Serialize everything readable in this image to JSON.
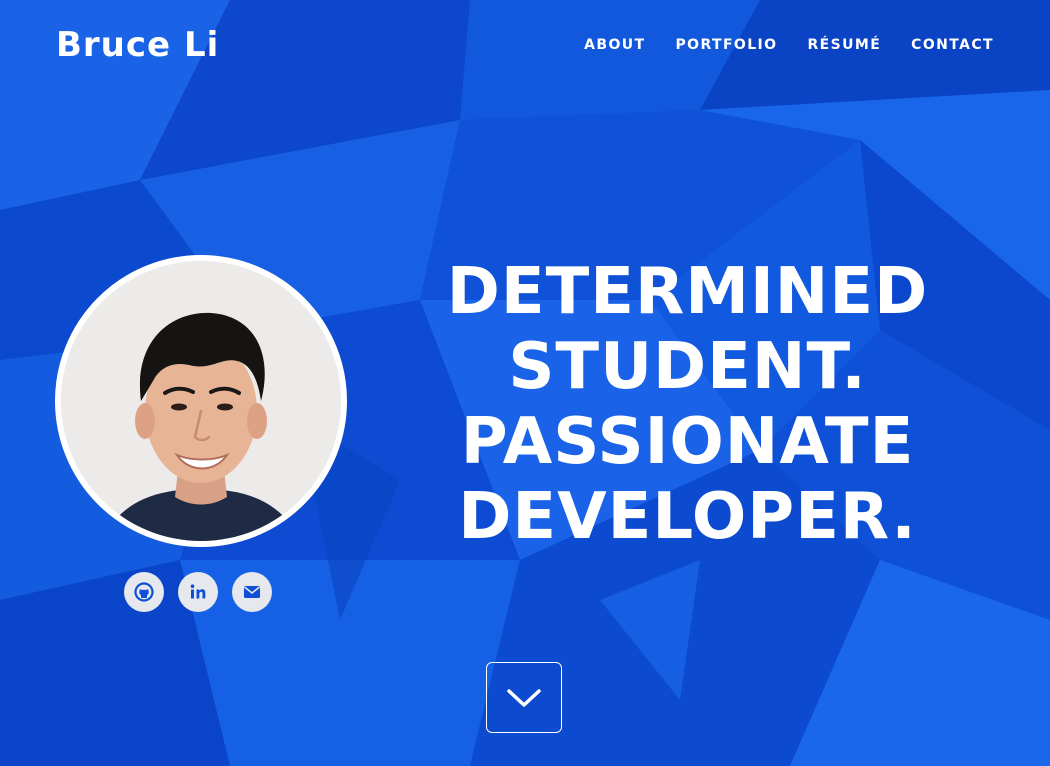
{
  "header": {
    "brand": "Bruce Li",
    "nav": [
      {
        "label": "ABOUT"
      },
      {
        "label": "PORTFOLIO"
      },
      {
        "label": "RÉSUMÉ"
      },
      {
        "label": "CONTACT"
      }
    ]
  },
  "hero": {
    "headline_lines": [
      "DETERMINED",
      "STUDENT.",
      "PASSIONATE",
      "DEVELOPER."
    ],
    "avatar_alt": "Bruce Li",
    "socials": [
      {
        "icon": "github-icon"
      },
      {
        "icon": "linkedin-icon"
      },
      {
        "icon": "envelope-icon"
      }
    ],
    "scroll_icon": "chevron-down-icon"
  },
  "colors": {
    "background": "#0d4fd6",
    "text": "#ffffff",
    "social_bg": "#e6e8ee",
    "social_icon": "#0d4fd6"
  }
}
